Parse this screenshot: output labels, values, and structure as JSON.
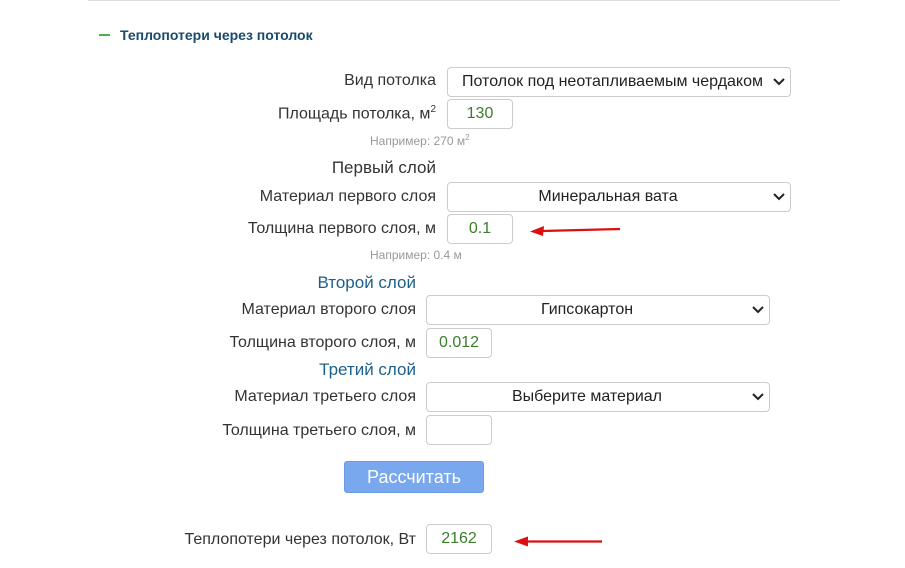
{
  "section": {
    "title": "Теплопотери через потолок"
  },
  "ceiling_type": {
    "label": "Вид потолка",
    "value": "Потолок под неотапливаемым чердаком"
  },
  "ceiling_area": {
    "label": "Площадь потолка, м",
    "label_sup": "2",
    "value": "130",
    "hint": "Например:",
    "hint_example": "270 м",
    "hint_sup": "2"
  },
  "layer1": {
    "title": "Первый слой",
    "material_label": "Материал первого слоя",
    "material_value": "Минеральная вата",
    "thickness_label": "Толщина первого слоя, м",
    "thickness_value": "0.1",
    "hint": "Например:",
    "hint_example": "0.4 м"
  },
  "layer2": {
    "title": "Второй слой",
    "material_label": "Материал второго слоя",
    "material_value": "Гипсокартон",
    "thickness_label": "Толщина второго слоя, м",
    "thickness_value": "0.012"
  },
  "layer3": {
    "title": "Третий слой",
    "material_label": "Материал третьего слоя",
    "material_value": "Выберите материал",
    "thickness_label": "Толщина третьего слоя, м",
    "thickness_value": ""
  },
  "calc_button": {
    "label": "Рассчитать"
  },
  "result": {
    "label": "Теплопотери через потолок, Вт",
    "value": "2162"
  },
  "colors": {
    "accent_green": "#4caf50",
    "title_blue": "#1a4a6b",
    "button_blue": "#79a8ee",
    "value_green": "#3a7d2b",
    "arrow_red": "#d9100f"
  }
}
